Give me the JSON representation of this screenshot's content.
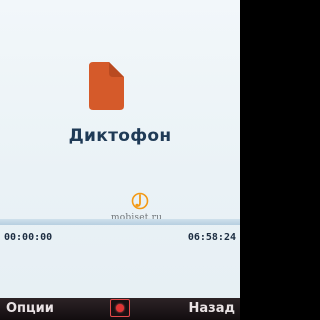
{
  "app": {
    "title": "Диктофон",
    "icon": "voice-recorder-icon",
    "icon_color": "#d55a2a"
  },
  "watermark": {
    "text": "mobiset.ru",
    "logo_color": "#f39a16"
  },
  "recorder": {
    "elapsed": "00:00:00",
    "remaining": "06:58:24",
    "progress": 0
  },
  "softkeys": {
    "left_label": "Опции",
    "center_icon": "record-icon",
    "right_label": "Назад",
    "record_color": "#e23434"
  }
}
